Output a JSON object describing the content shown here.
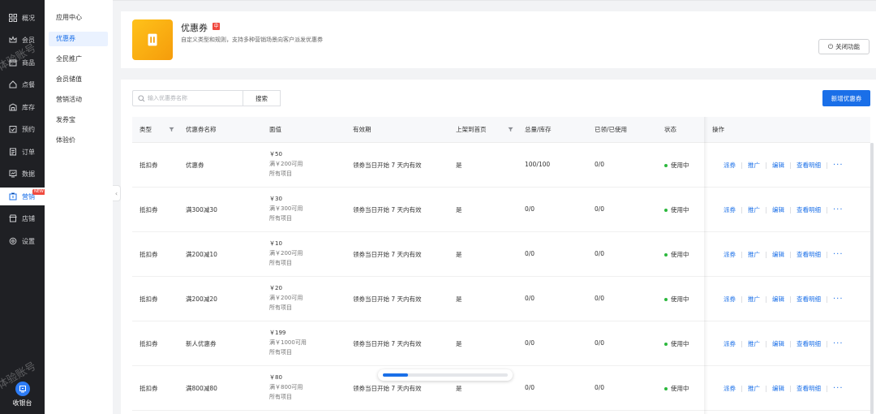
{
  "sidebar": {
    "items": [
      {
        "label": "概况",
        "icon": "grid-icon"
      },
      {
        "label": "会员",
        "icon": "crown-icon"
      },
      {
        "label": "商品",
        "icon": "box-icon"
      },
      {
        "label": "点餐",
        "icon": "home-icon"
      },
      {
        "label": "库存",
        "icon": "warehouse-icon"
      },
      {
        "label": "预约",
        "icon": "calendar-check-icon"
      },
      {
        "label": "订单",
        "icon": "order-icon"
      },
      {
        "label": "数据",
        "icon": "chart-icon"
      },
      {
        "label": "营销",
        "icon": "marketing-icon",
        "badge": "NEW"
      },
      {
        "label": "店铺",
        "icon": "shop-icon"
      },
      {
        "label": "设置",
        "icon": "settings-icon"
      }
    ],
    "active_index": 8,
    "watermark": "体验账号",
    "cashier_label": "收银台"
  },
  "subnav": {
    "items": [
      "应用中心",
      "优惠券",
      "全民推广",
      "会员储值",
      "营销活动",
      "发券宝",
      "体验价"
    ],
    "active_index": 1
  },
  "header": {
    "title": "优惠券",
    "tag": "中",
    "description": "自定义类型和规则，支持多种营销场景向客户派发优惠券",
    "close_button": "关闭功能"
  },
  "toolbar": {
    "search_placeholder": "输入优惠券名称",
    "search_button": "搜索",
    "new_button": "新增优惠券"
  },
  "table": {
    "columns": [
      "类型",
      "优惠券名称",
      "面值",
      "有效期",
      "上架到首页",
      "总量/库存",
      "已领/已使用",
      "状态",
      "操作"
    ],
    "rows": [
      {
        "type": "抵扣券",
        "name": "优惠券",
        "face": "￥50",
        "threshold": "满￥200可用",
        "scope": "所有项目",
        "validity": "领券当日开始 7 天内有效",
        "on_home": "是",
        "stock": "100/100",
        "used": "0/0",
        "status": "使用中"
      },
      {
        "type": "抵扣券",
        "name": "满300减30",
        "face": "￥30",
        "threshold": "满￥300可用",
        "scope": "所有项目",
        "validity": "领券当日开始 7 天内有效",
        "on_home": "是",
        "stock": "0/0",
        "used": "0/0",
        "status": "使用中"
      },
      {
        "type": "抵扣券",
        "name": "满200减10",
        "face": "￥10",
        "threshold": "满￥200可用",
        "scope": "所有项目",
        "validity": "领券当日开始 7 天内有效",
        "on_home": "是",
        "stock": "0/0",
        "used": "0/0",
        "status": "使用中"
      },
      {
        "type": "抵扣券",
        "name": "满200减20",
        "face": "￥20",
        "threshold": "满￥200可用",
        "scope": "所有项目",
        "validity": "领券当日开始 7 天内有效",
        "on_home": "是",
        "stock": "0/0",
        "used": "0/0",
        "status": "使用中"
      },
      {
        "type": "抵扣券",
        "name": "新人优惠券",
        "face": "￥199",
        "threshold": "满￥1000可用",
        "scope": "所有项目",
        "validity": "领券当日开始 7 天内有效",
        "on_home": "是",
        "stock": "0/0",
        "used": "0/0",
        "status": "使用中"
      },
      {
        "type": "抵扣券",
        "name": "满800减80",
        "face": "￥80",
        "threshold": "满￥800可用",
        "scope": "所有项目",
        "validity": "领券当日开始 7 天内有效",
        "on_home": "是",
        "stock": "0/0",
        "used": "0/0",
        "status": "使用中"
      }
    ],
    "actions": [
      "派券",
      "推广",
      "编辑",
      "查看明细"
    ],
    "more_label": "···"
  },
  "loading_progress": 0.2,
  "colors": {
    "accent": "#1a6fe8",
    "sidebar_bg": "#1f2024",
    "status_green": "#2cb83d",
    "tag_red": "#f0463c",
    "coupon_icon": "#ffb814"
  }
}
